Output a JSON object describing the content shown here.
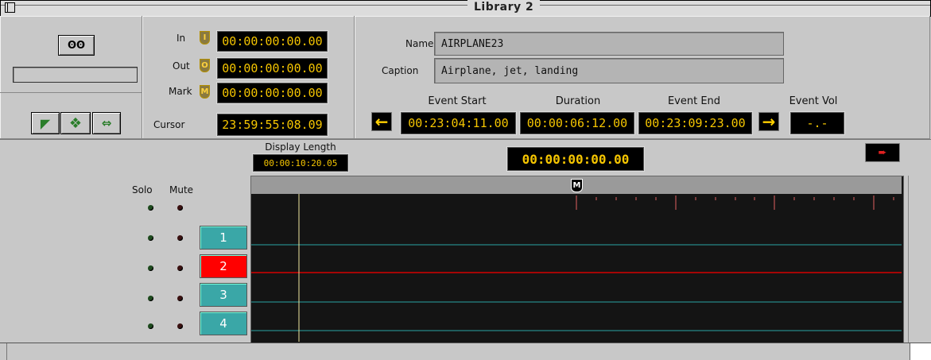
{
  "window": {
    "title": "Library 2"
  },
  "deck": {
    "deck_icon": "tape-reel-icon",
    "tools": [
      "arrow-pointer-icon",
      "move-arrows-icon",
      "horizontal-arrows-icon"
    ]
  },
  "timecodes": {
    "in_label": "In",
    "in_badge": "I",
    "in_value": "00:00:00:00.00",
    "out_label": "Out",
    "out_badge": "O",
    "out_value": "00:00:00:00.00",
    "mark_label": "Mark",
    "mark_badge": "M",
    "mark_value": "00:00:00:00.00",
    "cursor_label": "Cursor",
    "cursor_value": "23:59:55:08.09"
  },
  "info": {
    "name_label": "Name",
    "name_value": "AIRPLANE23",
    "caption_label": "Caption",
    "caption_value": "Airplane, jet, landing"
  },
  "events": {
    "start_label": "Event Start",
    "start_value": "00:23:04:11.00",
    "duration_label": "Duration",
    "duration_value": "00:00:06:12.00",
    "end_label": "Event End",
    "end_value": "00:23:09:23.00",
    "vol_label": "Event Vol",
    "vol_value": "-.-"
  },
  "timeline": {
    "display_length_label": "Display Length",
    "display_length_value": "00:00:10:20.05",
    "position_value": "00:00:00:00.00",
    "solo_label": "Solo",
    "mute_label": "Mute",
    "marker_label": "M",
    "tracks": [
      {
        "label": "1",
        "selected": false
      },
      {
        "label": "2",
        "selected": true
      },
      {
        "label": "3",
        "selected": false
      },
      {
        "label": "4",
        "selected": false
      }
    ],
    "colors": {
      "track": "#3aa7a7",
      "selected": "#ff0000",
      "lcd_text": "#f5c500",
      "line_teal": "#2aa3a3",
      "line_red": "#d40000"
    }
  }
}
